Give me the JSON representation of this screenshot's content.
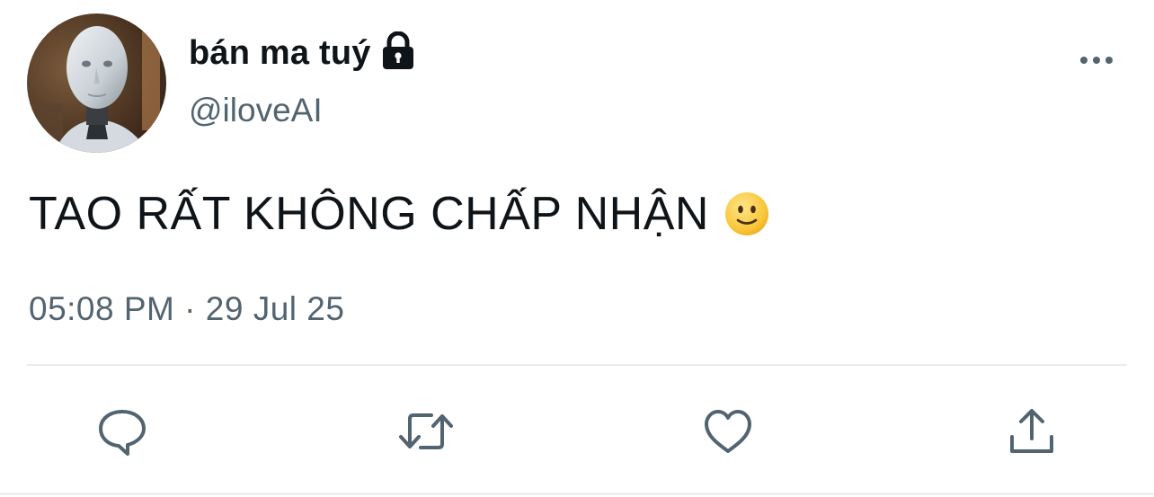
{
  "user": {
    "display_name": "bán ma tuý",
    "handle": "@iloveAI",
    "avatar_icon": "robot-avatar",
    "protected_icon": "lock-icon"
  },
  "tweet": {
    "text": "TAO RẤT KHÔNG CHẤP NHẬN",
    "emoji": "slightly-smiling-face-emoji"
  },
  "meta": {
    "time": "05:08 PM",
    "separator": "·",
    "date": "29 Jul 25"
  },
  "actions": [
    {
      "name": "reply",
      "icon": "reply-icon"
    },
    {
      "name": "retweet",
      "icon": "retweet-icon"
    },
    {
      "name": "like",
      "icon": "heart-icon"
    },
    {
      "name": "share",
      "icon": "share-icon"
    }
  ],
  "colors": {
    "text_primary": "#0f1419",
    "text_secondary": "#536471",
    "divider": "#e6ecf0"
  }
}
